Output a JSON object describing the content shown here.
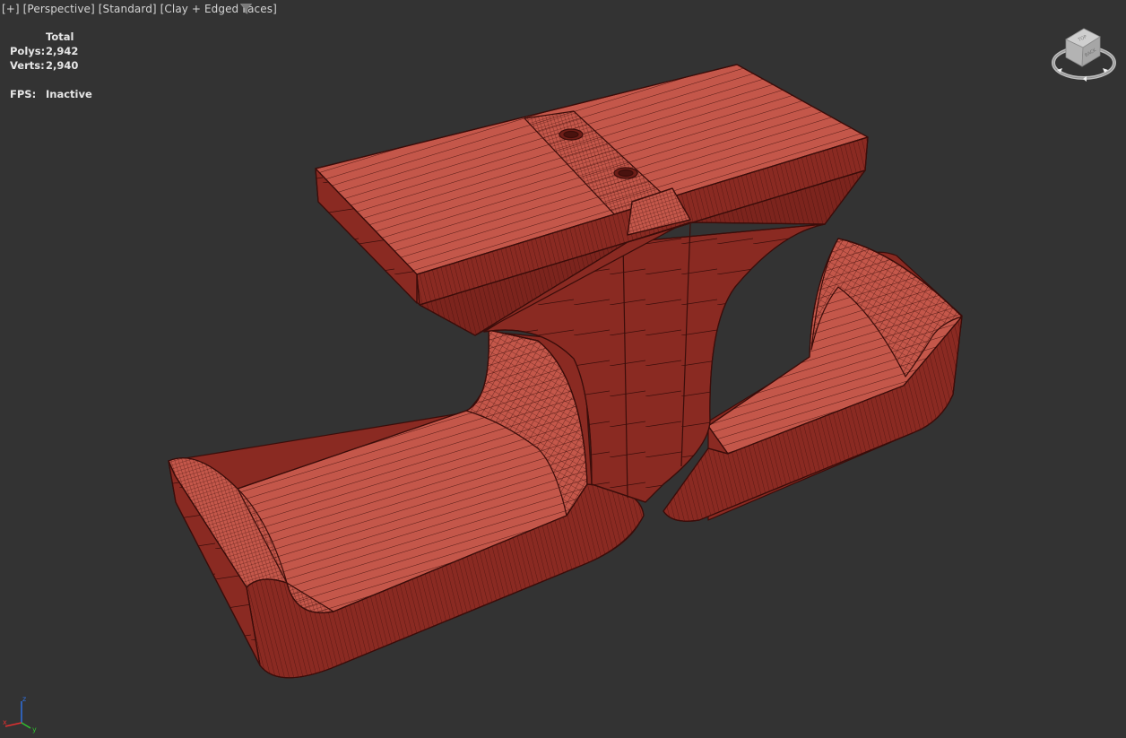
{
  "viewport": {
    "label_parts": [
      "[+]",
      "[Perspective]",
      "[Standard]",
      "[Clay + Edged Faces]"
    ]
  },
  "stats": {
    "header": "Total",
    "polys_label": "Polys:",
    "polys_value": "2,942",
    "verts_label": "Verts:",
    "verts_value": "2,940"
  },
  "fps": {
    "label": "FPS:",
    "value": "Inactive"
  },
  "viewcube": {
    "faces": [
      "TOP",
      "BACK"
    ]
  },
  "axis": {
    "x": "x",
    "y": "y",
    "z": "z"
  },
  "colors": {
    "background": "#333333",
    "model_face": "#c4574a",
    "model_side": "#8a2a22",
    "edge": "#3a0d0a",
    "axis_x": "#e03030",
    "axis_y": "#30c030",
    "axis_z": "#3070e0"
  },
  "icons": [
    "filter-icon",
    "viewcube-icon",
    "axis-tripod-icon"
  ]
}
